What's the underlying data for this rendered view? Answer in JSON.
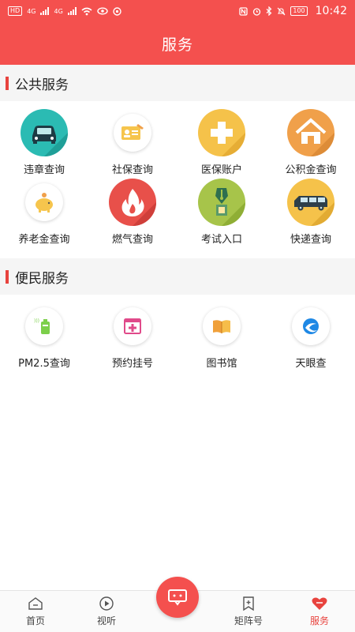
{
  "status": {
    "time": "10:42",
    "battery": "100",
    "hd_badge": "HD",
    "signal_1": "4G",
    "signal_2": "4G"
  },
  "header": {
    "title": "服务"
  },
  "sections": [
    {
      "title": "公共服务"
    },
    {
      "title": "便民服务"
    }
  ],
  "public_services": [
    {
      "label": "违章查询",
      "icon": "car-icon",
      "color": "#2bbbb3"
    },
    {
      "label": "社保查询",
      "icon": "id-card-icon",
      "color": "#ffffff"
    },
    {
      "label": "医保账户",
      "icon": "medical-cross-icon",
      "color": "#f5c24a"
    },
    {
      "label": "公积金查询",
      "icon": "house-icon",
      "color": "#f0a04a"
    },
    {
      "label": "养老金查询",
      "icon": "piggy-bank-icon",
      "color": "#ffffff"
    },
    {
      "label": "燃气查询",
      "icon": "flame-icon",
      "color": "#e8504a"
    },
    {
      "label": "考试入口",
      "icon": "pen-nib-icon",
      "color": "#a7c44a"
    },
    {
      "label": "快递查询",
      "icon": "delivery-van-icon",
      "color": "#f5c24a"
    }
  ],
  "convenience_services": [
    {
      "label": "PM2.5查询",
      "icon": "air-quality-icon"
    },
    {
      "label": "预约挂号",
      "icon": "hospital-register-icon"
    },
    {
      "label": "图书馆",
      "icon": "book-icon"
    },
    {
      "label": "天眼查",
      "icon": "tianyancha-icon"
    }
  ],
  "tabbar": [
    {
      "label": "首页",
      "icon": "home-icon"
    },
    {
      "label": "视听",
      "icon": "play-icon"
    },
    {
      "label": "",
      "icon": "message-icon"
    },
    {
      "label": "矩阵号",
      "icon": "bookmark-icon"
    },
    {
      "label": "服务",
      "icon": "heart-icon",
      "active": true
    }
  ],
  "colors": {
    "brand_red": "#f4504e",
    "accent_red": "#e8433e"
  }
}
